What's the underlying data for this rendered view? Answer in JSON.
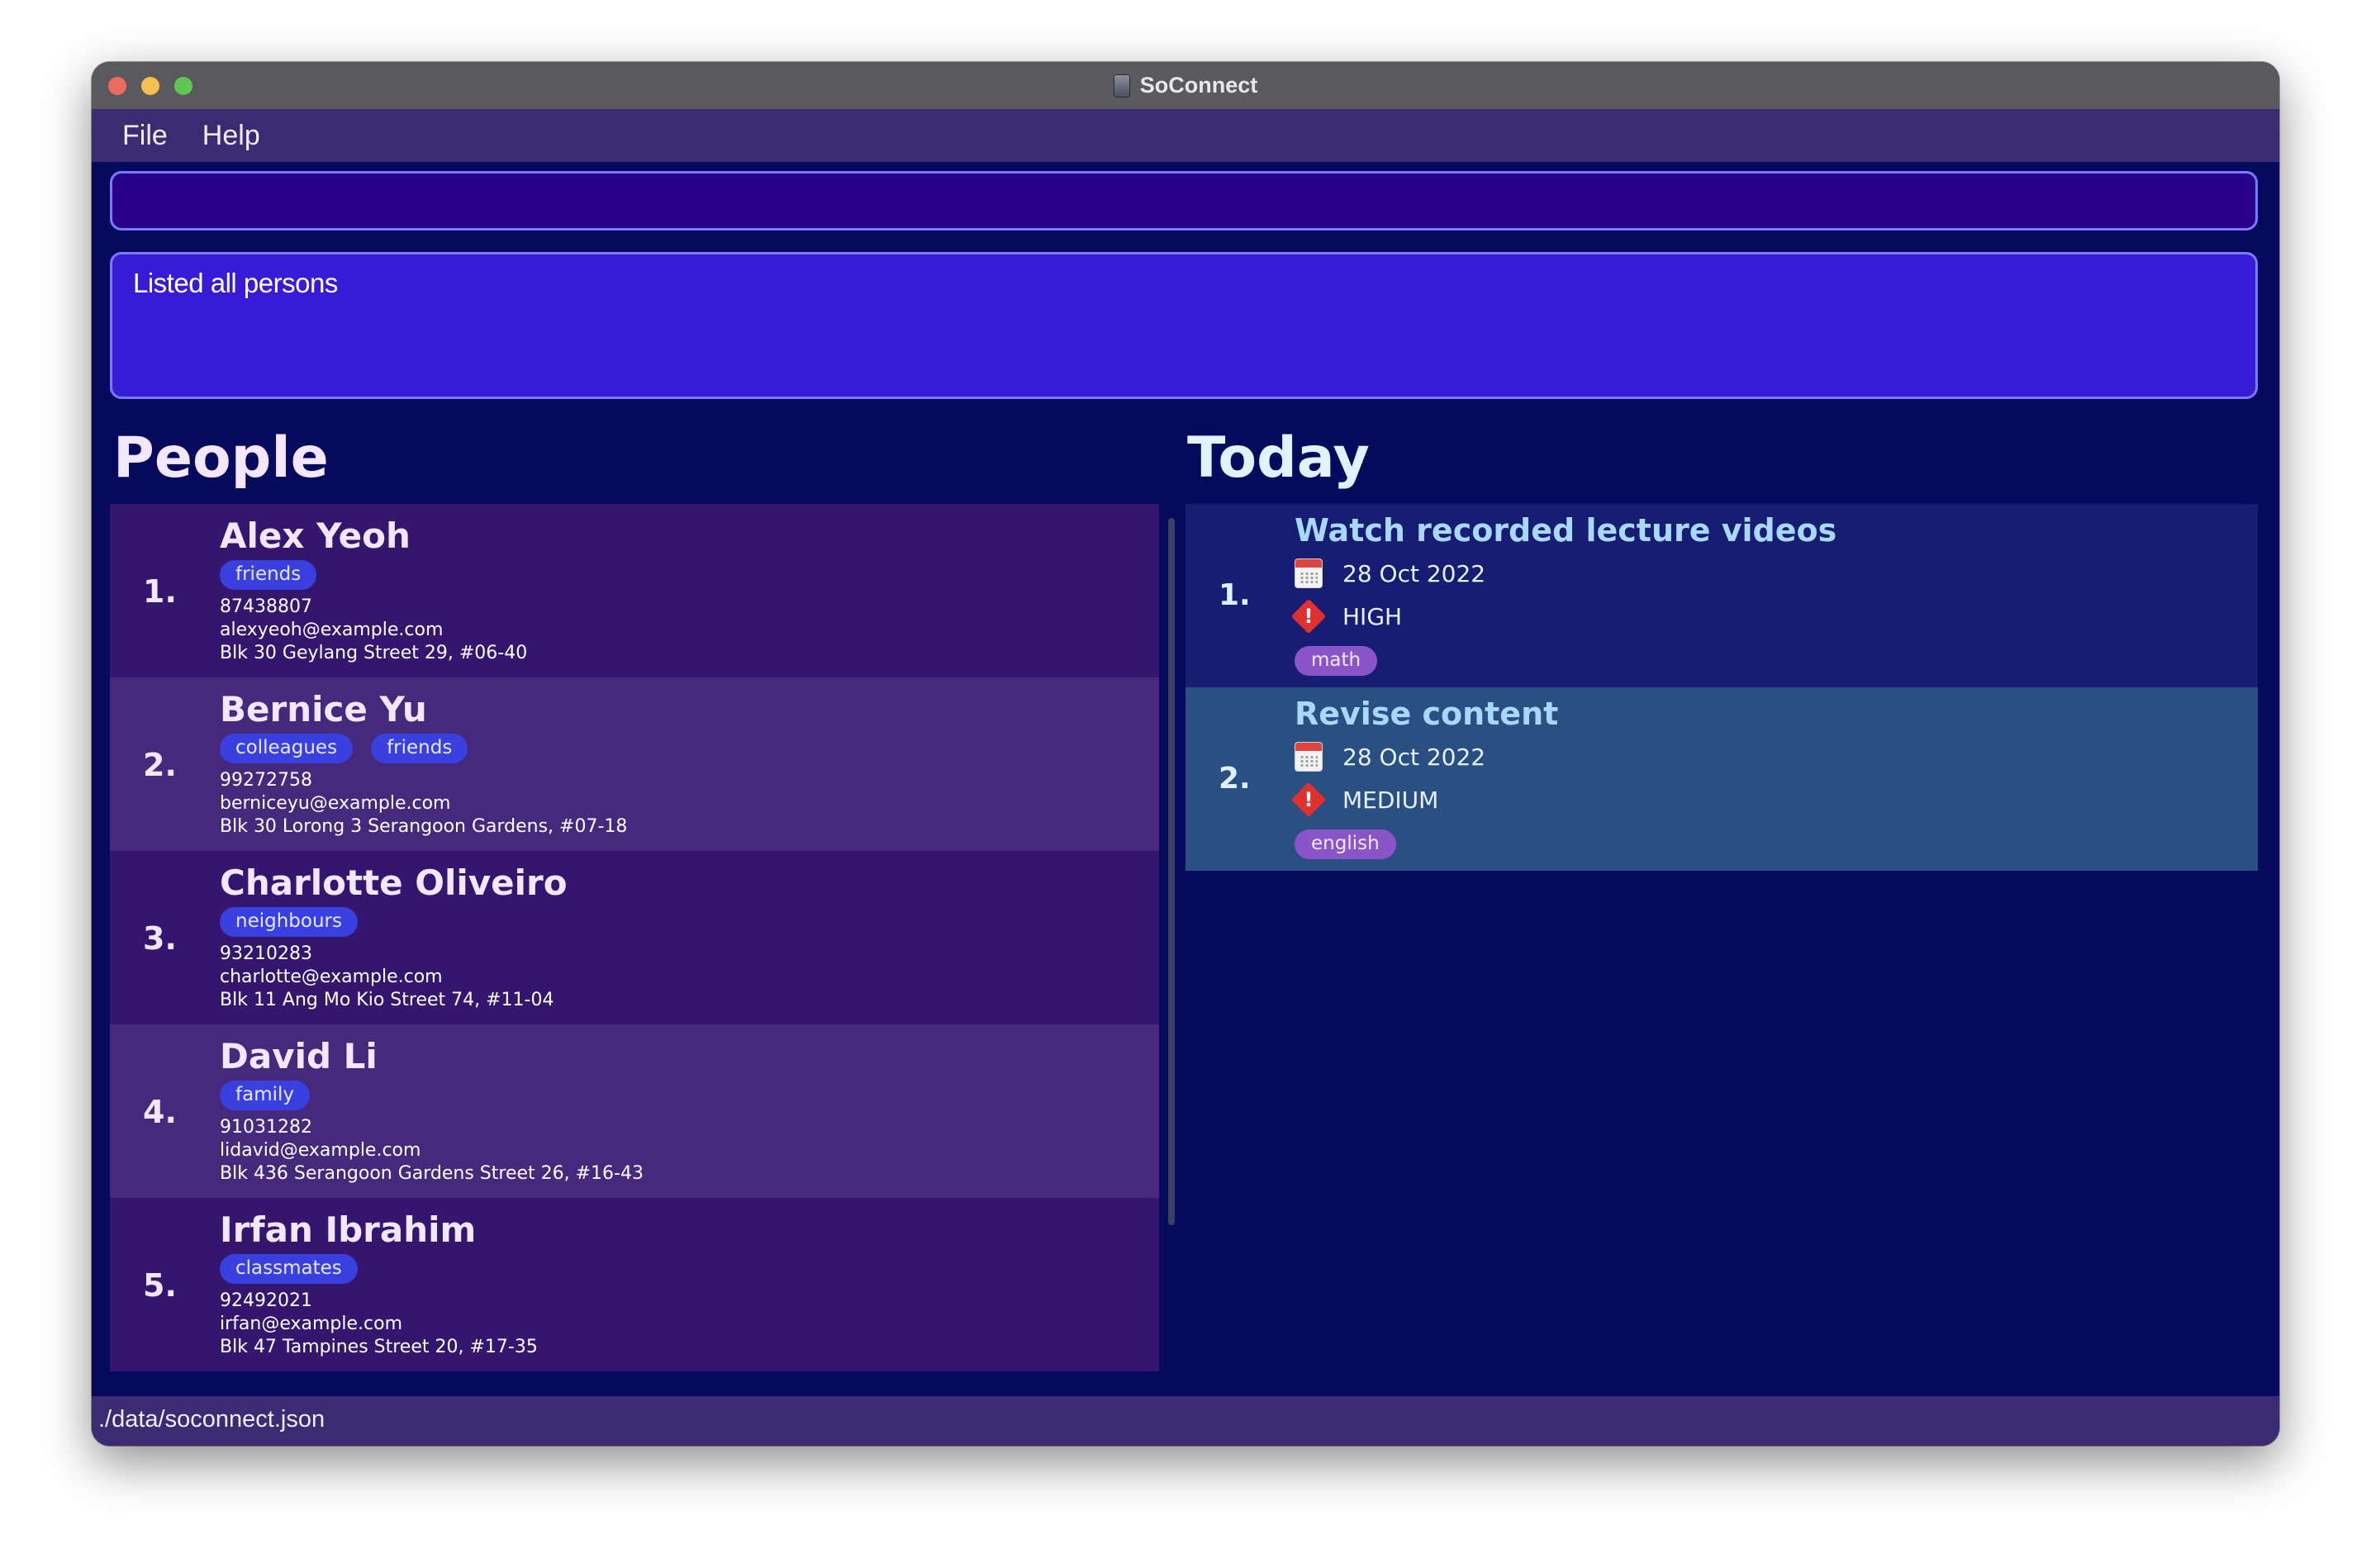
{
  "window": {
    "title": "SoConnect"
  },
  "menu": {
    "items": [
      {
        "label": "File"
      },
      {
        "label": "Help"
      }
    ]
  },
  "command": {
    "value": ""
  },
  "result": {
    "text": "Listed all persons"
  },
  "people": {
    "title": "People",
    "persons": [
      {
        "index": "1.",
        "name": "Alex Yeoh",
        "tags": [
          "friends"
        ],
        "phone": "87438807",
        "email": "alexyeoh@example.com",
        "address": "Blk 30 Geylang Street 29, #06-40"
      },
      {
        "index": "2.",
        "name": "Bernice Yu",
        "tags": [
          "colleagues",
          "friends"
        ],
        "phone": "99272758",
        "email": "berniceyu@example.com",
        "address": "Blk 30 Lorong 3 Serangoon Gardens, #07-18"
      },
      {
        "index": "3.",
        "name": "Charlotte Oliveiro",
        "tags": [
          "neighbours"
        ],
        "phone": "93210283",
        "email": "charlotte@example.com",
        "address": "Blk 11 Ang Mo Kio Street 74, #11-04"
      },
      {
        "index": "4.",
        "name": "David Li",
        "tags": [
          "family"
        ],
        "phone": "91031282",
        "email": "lidavid@example.com",
        "address": "Blk 436 Serangoon Gardens Street 26, #16-43"
      },
      {
        "index": "5.",
        "name": "Irfan Ibrahim",
        "tags": [
          "classmates"
        ],
        "phone": "92492021",
        "email": "irfan@example.com",
        "address": "Blk 47 Tampines Street 20, #17-35"
      }
    ]
  },
  "today": {
    "title": "Today",
    "tasks": [
      {
        "index": "1.",
        "name": "Watch recorded lecture videos",
        "date": "28 Oct 2022",
        "priority": "HIGH",
        "tag": "math"
      },
      {
        "index": "2.",
        "name": "Revise content",
        "date": "28 Oct 2022",
        "priority": "MEDIUM",
        "tag": "english"
      }
    ]
  },
  "status": {
    "path": "./data/soconnect.json"
  },
  "icons": {
    "calendar": "calendar-icon",
    "priority": "priority-warning-icon"
  },
  "colors": {
    "background": "#050a5c",
    "menubar": "#3b2b72",
    "command_box": "#27018a",
    "result_box": "#371bd6",
    "person_card": "#34166e",
    "person_card_alt": "#45297d",
    "person_tag": "#3a3fe0",
    "task_card": "#171d73",
    "task_card_alt": "#2a4f83",
    "task_tag": "#8a55c8",
    "priority": "#e0302f"
  }
}
